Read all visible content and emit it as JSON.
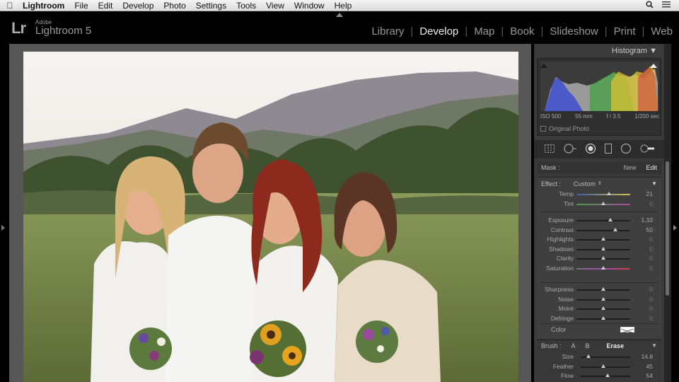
{
  "menubar": {
    "app_name": "Lightroom",
    "items": [
      "File",
      "Edit",
      "Develop",
      "Photo",
      "Settings",
      "Tools",
      "View",
      "Window",
      "Help"
    ]
  },
  "header": {
    "logo": "Lr",
    "brand_small": "Adobe",
    "brand_product": "Lightroom 5",
    "modules": [
      {
        "label": "Library",
        "active": false
      },
      {
        "label": "Develop",
        "active": true
      },
      {
        "label": "Map",
        "active": false
      },
      {
        "label": "Book",
        "active": false
      },
      {
        "label": "Slideshow",
        "active": false
      },
      {
        "label": "Print",
        "active": false
      },
      {
        "label": "Web",
        "active": false
      }
    ]
  },
  "histogram": {
    "title": "Histogram",
    "iso": "ISO 500",
    "focal": "55 mm",
    "aperture": "f / 3.5",
    "shutter": "1/200 sec",
    "original_photo": "Original Photo"
  },
  "mask": {
    "label": "Mask :",
    "new": "New",
    "edit": "Edit"
  },
  "effect": {
    "label": "Effect :",
    "value": "Custom",
    "sliders_group1": [
      {
        "label": "Temp",
        "value": "21",
        "pos": 0.6,
        "kind": "temp"
      },
      {
        "label": "Tint",
        "value": "0",
        "pos": 0.5,
        "kind": "tint"
      }
    ],
    "sliders_group2": [
      {
        "label": "Exposure",
        "value": "1.33",
        "pos": 0.63
      },
      {
        "label": "Contrast",
        "value": "50",
        "pos": 0.72
      },
      {
        "label": "Highlights",
        "value": "0",
        "pos": 0.5
      },
      {
        "label": "Shadows",
        "value": "0",
        "pos": 0.5
      },
      {
        "label": "Clarity",
        "value": "0",
        "pos": 0.5
      },
      {
        "label": "Saturation",
        "value": "0",
        "pos": 0.5,
        "kind": "sat"
      }
    ],
    "sliders_group3": [
      {
        "label": "Sharpness",
        "value": "0",
        "pos": 0.5
      },
      {
        "label": "Noise",
        "value": "0",
        "pos": 0.5
      },
      {
        "label": "Moiré",
        "value": "0",
        "pos": 0.5
      },
      {
        "label": "Defringe",
        "value": "0",
        "pos": 0.5
      }
    ],
    "color_label": "Color"
  },
  "brush": {
    "label": "Brush :",
    "a": "A",
    "b": "B",
    "erase": "Erase",
    "sliders": [
      {
        "label": "Size",
        "value": "14.8",
        "pos": 0.15
      },
      {
        "label": "Feather",
        "value": "45",
        "pos": 0.45
      },
      {
        "label": "Flow",
        "value": "54",
        "pos": 0.54
      }
    ]
  }
}
